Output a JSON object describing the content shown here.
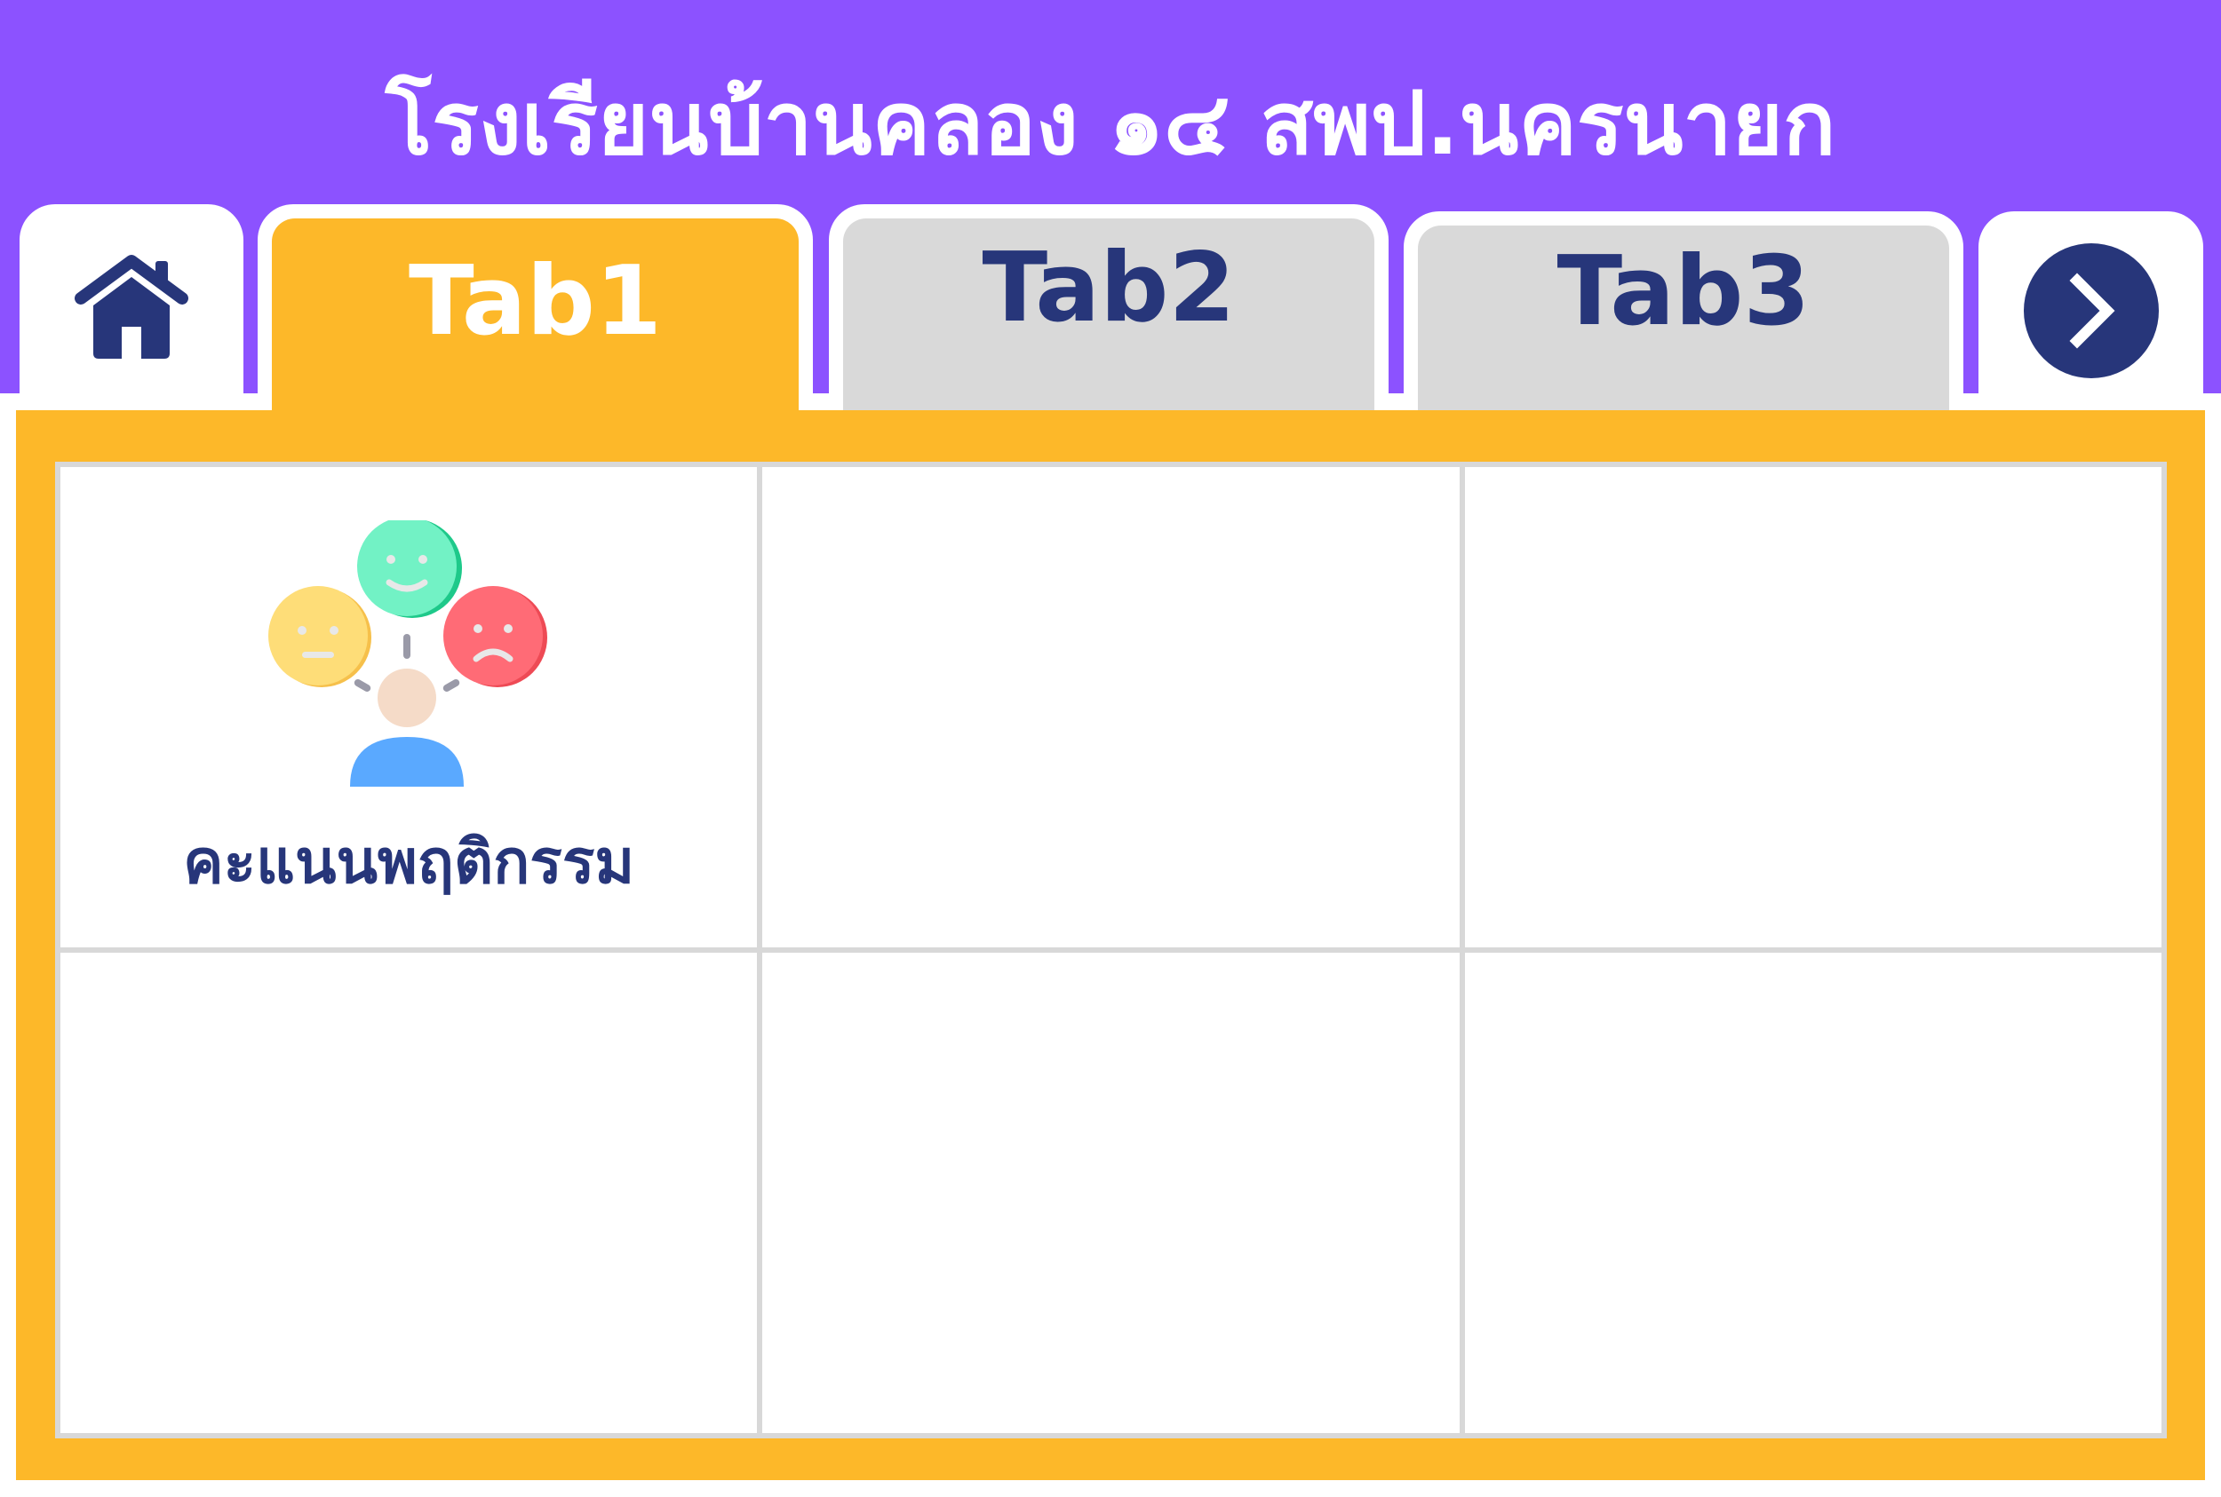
{
  "header": {
    "title": "โรงเรียนบ้านคลอง ๑๔ สพป.นครนายก",
    "background_color": "#8c52ff"
  },
  "tabs": [
    {
      "label": "Tab1",
      "active": true
    },
    {
      "label": "Tab2",
      "active": false
    },
    {
      "label": "Tab3",
      "active": false
    }
  ],
  "nav": {
    "home_icon": "home-icon",
    "next_icon": "chevron-right-icon"
  },
  "grid": {
    "tiles": [
      {
        "label": "คะแนนพฤติกรรม",
        "icon": "behavior-emotions-icon"
      }
    ]
  },
  "colors": {
    "accent": "#fdb829",
    "navy": "#27367a",
    "inactive_tab": "#d9d9d9"
  }
}
